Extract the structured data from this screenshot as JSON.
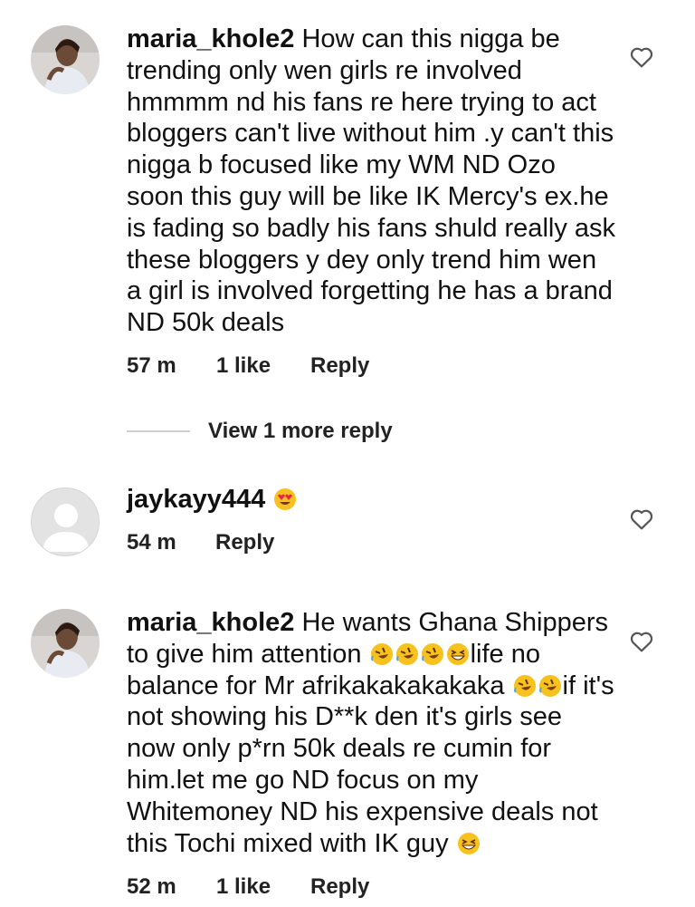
{
  "comments": [
    {
      "username": "maria_khole2",
      "text": "How can this nigga be trending only wen girls re involved hmmmm nd his fans re here trying to act bloggers can't live without him .y can't this nigga b focused like my WM ND Ozo soon this guy will be like IK Mercy's ex.he is fading so badly his fans shuld really ask these bloggers y dey only trend him wen a girl is involved forgetting he has a brand ND 50k deals",
      "time": "57 m",
      "likes": "1 like",
      "reply_label": "Reply"
    },
    {
      "username": "jaykayy444",
      "time": "54 m",
      "reply_label": "Reply"
    },
    {
      "username": "maria_khole2",
      "text_part1": "He wants Ghana Shippers to give him attention",
      "text_part2": "life no balance for Mr afrikakakakakaka",
      "text_part3": "if it's not showing his D**k den it's girls see now only p*rn 50k deals re cumin for him.let me go ND focus on my Whitemoney ND his expensive deals not this Tochi mixed with IK guy",
      "time": "52 m",
      "likes": "1 like",
      "reply_label": "Reply"
    }
  ],
  "view_more_label": "View 1 more reply",
  "icons": {
    "heart": "heart-outline-icon",
    "heart_eyes": "heart-eyes-emoji",
    "rofl": "rolling-laughing-emoji",
    "grin": "grinning-squinting-emoji"
  },
  "colors": {
    "text": "#111111",
    "meta": "#222222",
    "divider": "#cfcfcf",
    "heart": "#555555",
    "emoji": "#f7c21e"
  }
}
